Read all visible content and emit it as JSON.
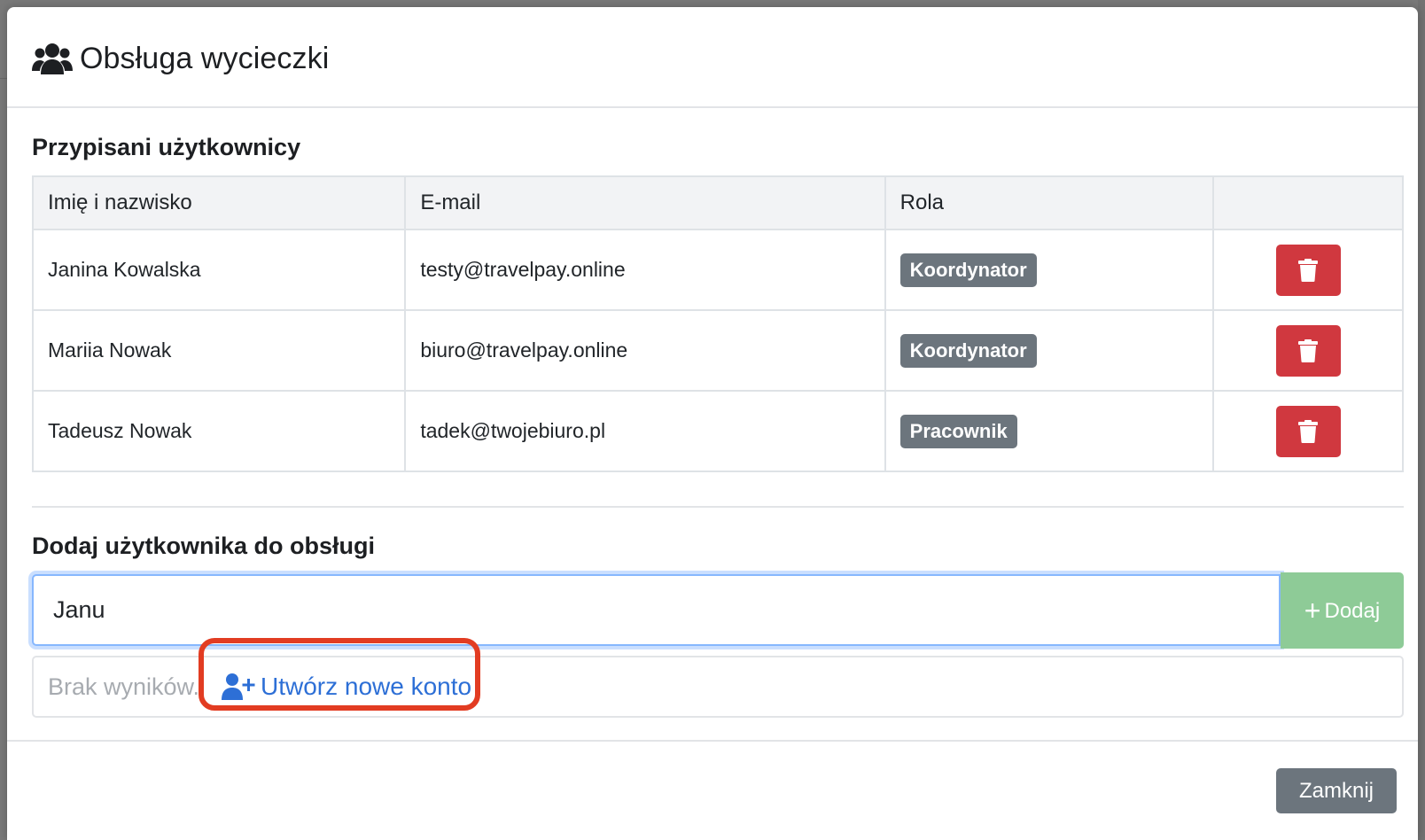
{
  "modal": {
    "title": "Obsługa wycieczki",
    "title_icon": "users-icon"
  },
  "assigned": {
    "heading": "Przypisani użytkownicy",
    "columns": [
      "Imię i nazwisko",
      "E-mail",
      "Rola",
      ""
    ],
    "rows": [
      {
        "name": "Janina Kowalska",
        "email": "testy@travelpay.online",
        "role": "Koordynator"
      },
      {
        "name": "Mariia Nowak",
        "email": "biuro@travelpay.online",
        "role": "Koordynator"
      },
      {
        "name": "Tadeusz Nowak",
        "email": "tadek@twojebiuro.pl",
        "role": "Pracownik"
      }
    ],
    "delete_icon": "trash-icon"
  },
  "add_user": {
    "heading": "Dodaj użytkownika do obsługi",
    "search_value": "Janu",
    "add_label": "Dodaj",
    "no_results": "Brak wyników.",
    "create_account_label": "Utwórz nowe konto",
    "create_account_icon": "user-plus-icon"
  },
  "footer": {
    "close_label": "Zamknij"
  },
  "colors": {
    "danger": "#d0383f",
    "success_disabled": "#8ecb97",
    "secondary": "#6c757d",
    "link": "#2d6fd6",
    "highlight": "#e23c22"
  }
}
